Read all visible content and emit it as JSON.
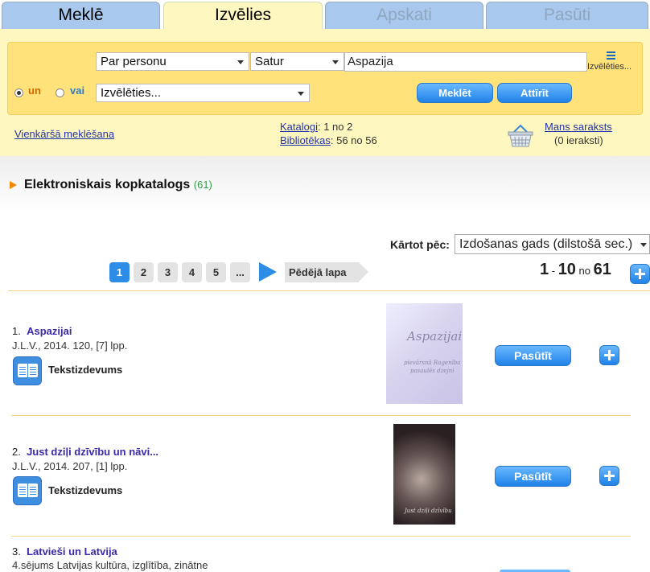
{
  "tabs": [
    "Meklē",
    "Izvēlies",
    "Apskati",
    "Pasūti"
  ],
  "search": {
    "field": "Par personu",
    "operator": "Satur",
    "query": "Aspazija",
    "choose_link": "Izvēlēties...",
    "second_field": "Izvēlēties...",
    "radio_and": "un",
    "radio_or": "vai",
    "search_button": "Meklēt",
    "clear_button": "Attīrīt"
  },
  "info": {
    "simple_search": "Vienkāršā meklēšana",
    "catalogs_label": "Katalogi",
    "catalogs_value": ": 1 no 2",
    "libraries_label": "Bibliotēkas",
    "libraries_value": ": 56 no 56",
    "my_list": "Mans saraksts",
    "my_list_count": "(0 ieraksti)"
  },
  "catalog": {
    "title": "Elektroniskais kopkatalogs",
    "count": "(61)"
  },
  "sort": {
    "label": "Kārtot pēc:",
    "value": "Izdošanas gads (dilstošā sec.)"
  },
  "pager": {
    "pages": [
      "1",
      "2",
      "3",
      "4",
      "5",
      "..."
    ],
    "last_page": "Pēdējā lapa",
    "range_from": "1",
    "range_sep": " - ",
    "range_to": "10",
    "range_no": " no ",
    "range_total": "61"
  },
  "results": [
    {
      "num": "1.",
      "title": "Aspazijai",
      "meta": "J.L.V., 2014. 120, [7] lpp.",
      "type": "Tekstizdevums",
      "order": "Pasūtīt",
      "cover_title": "Aspazijai",
      "cover_sub1": "pievārsnā Ragenība",
      "cover_sub2": "pasaulēs dzejnī"
    },
    {
      "num": "2.",
      "title": "Just dziļi dzīvību un nāvi...",
      "meta": "J.L.V., 2014. 207, [1] lpp.",
      "type": "Tekstizdevums",
      "order": "Pasūtīt",
      "cover_title": "Just dziļi dzīvību"
    },
    {
      "num": "3.",
      "title": "Latvieši un Latvija",
      "meta": "4.sējums Latvijas kultūra, izglītība, zinātne"
    }
  ]
}
